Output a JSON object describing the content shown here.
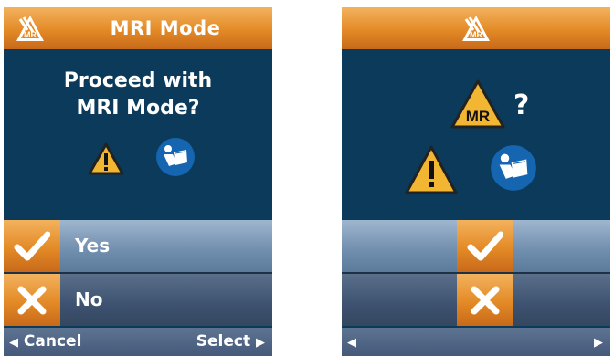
{
  "left_screen": {
    "title": "MRI Mode",
    "prompt_line1": "Proceed with",
    "prompt_line2": "MRI Mode?",
    "options": [
      {
        "label": "Yes",
        "icon": "check-icon"
      },
      {
        "label": "No",
        "icon": "x-icon"
      }
    ],
    "cancel_label": "Cancel",
    "select_label": "Select"
  },
  "right_screen": {
    "question_mark": "?",
    "mr_badge_text": "MR",
    "options": [
      {
        "icon": "check-icon"
      },
      {
        "icon": "x-icon"
      }
    ]
  },
  "logo": {
    "text": "MR"
  },
  "colors": {
    "screen_bg": "#0b3a5b",
    "accent_orange": "#e38a26",
    "selected_row": "#7f9ab8",
    "unselected_row": "#3f5472",
    "warning_yellow": "#f2b632",
    "manual_blue": "#1565b0"
  }
}
